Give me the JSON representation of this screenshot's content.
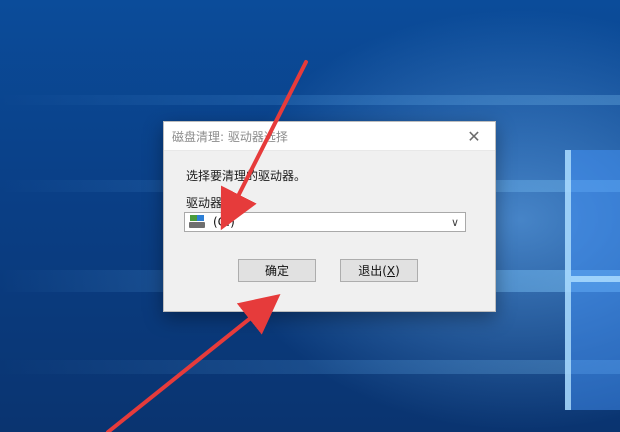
{
  "dialog": {
    "title": "磁盘清理: 驱动器选择",
    "instruction": "选择要清理的驱动器。",
    "drive_label_prefix": "驱动器",
    "drive_label_suffix": "(D):",
    "drive_label_mnemonic": "",
    "selected_drive": "(C:)",
    "ok_label": "确定",
    "exit_prefix": "退出(",
    "exit_mnemonic": "X",
    "exit_suffix": ")"
  },
  "colors": {
    "annotation_arrow": "#e63b3b",
    "dialog_bg": "#f0f0f0",
    "desktop_blue": "#0a3f86"
  },
  "icons": {
    "close": "close-icon",
    "drive": "drive-icon",
    "dropdown": "chevron-down-icon"
  }
}
